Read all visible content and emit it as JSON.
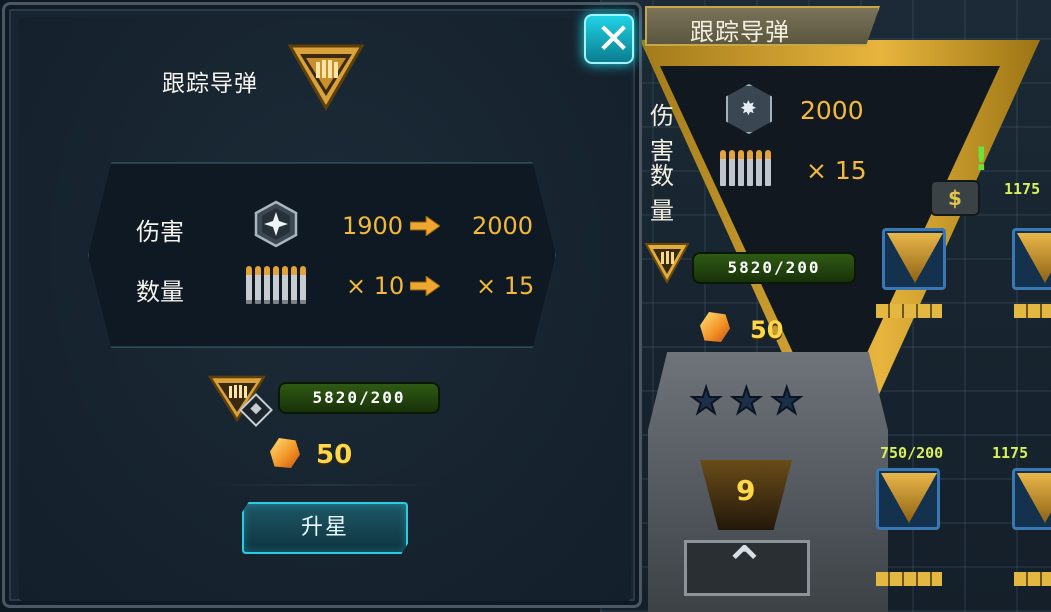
{
  "dialog": {
    "title": "跟踪导弹",
    "close_label": "✕",
    "stats": [
      {
        "label": "伤害",
        "icon": "damage-hex-icon",
        "from": "1900",
        "to": "2000"
      },
      {
        "label": "数量",
        "icon": "bullets-icon",
        "from": "× 10",
        "to": "× 15"
      }
    ],
    "shards": "5820/200",
    "gem_cost": "50",
    "upgrade_label": "升星"
  },
  "background": {
    "title": "跟踪导弹",
    "damage_label": "伤害",
    "damage_value": "2000",
    "count_label": "数量",
    "count_value": "× 15",
    "shards": "5820/200",
    "gem_cost": "50",
    "level": "9",
    "slot_counts": [
      "1175",
      "750/200",
      "1175"
    ]
  },
  "colors": {
    "accent_gold": "#f2b83a",
    "accent_cyan": "#2ecbe0",
    "panel_bg": "#172431",
    "shard_green": "#2f5a14"
  }
}
